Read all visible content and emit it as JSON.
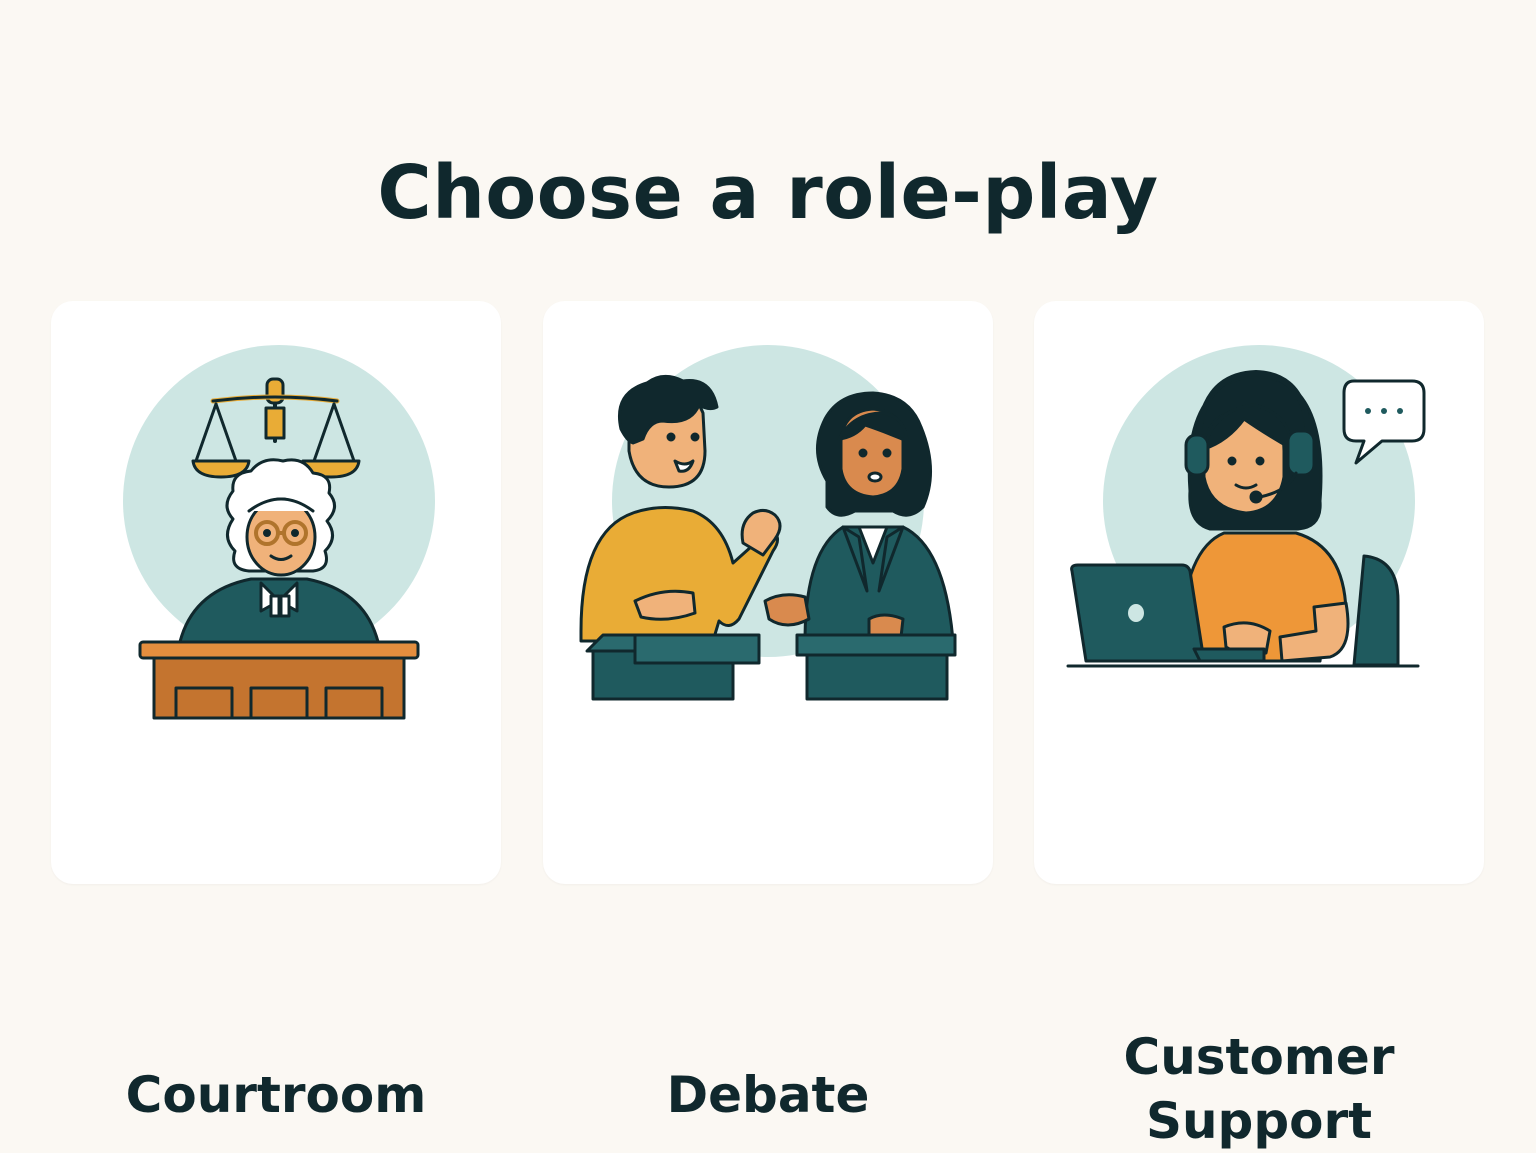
{
  "page": {
    "title": "Choose a role-play"
  },
  "cards": [
    {
      "label": "Courtroom",
      "illustration": "judge-icon"
    },
    {
      "label": "Debate",
      "illustration": "debaters-icon"
    },
    {
      "label_lines": [
        "Customer",
        "Support"
      ],
      "illustration": "support-agent-icon"
    }
  ],
  "colors": {
    "background": "#fbf8f3",
    "card": "#ffffff",
    "ink": "#10282d",
    "circle": "#cde6e3",
    "teal": "#1f5a5e",
    "mustard": "#e9ac36",
    "orange": "#ee9738",
    "wood": "#c4742f"
  }
}
